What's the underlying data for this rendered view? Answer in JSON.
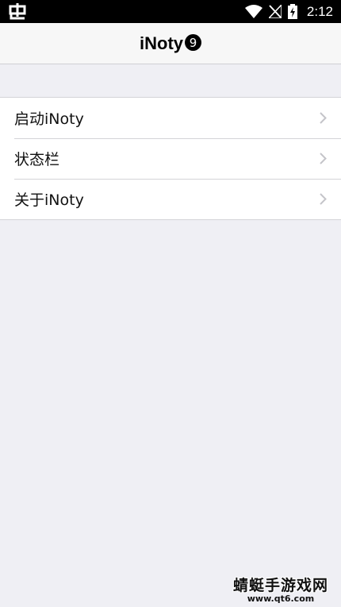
{
  "status_bar": {
    "time": "2:12",
    "left_icon": "bug-icon",
    "icons": [
      "wifi-icon",
      "signal-off-icon",
      "battery-charging-icon"
    ]
  },
  "nav": {
    "title": "iNoty",
    "badge": "9"
  },
  "menu": {
    "items": [
      {
        "label": "启动iNoty",
        "icon": "chevron-right-icon"
      },
      {
        "label": "状态栏",
        "icon": "chevron-right-icon"
      },
      {
        "label": "关于iNoty",
        "icon": "chevron-right-icon"
      }
    ]
  },
  "watermark": {
    "name": "蜻蜓手游戏网",
    "url": "www.qt6.com"
  }
}
